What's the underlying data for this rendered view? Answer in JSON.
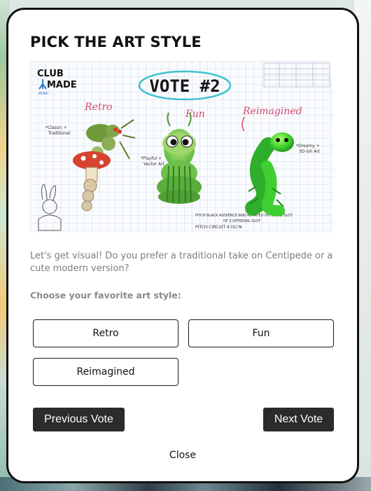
{
  "modal": {
    "title": "PICK THE ART STYLE",
    "description": "Let's get visual! Do you prefer a traditional take on Centipede or a cute modern version?",
    "prompt": "Choose your favorite art style:",
    "options": [
      {
        "label": "Retro"
      },
      {
        "label": "Fun"
      },
      {
        "label": "Reimagined"
      }
    ],
    "previous_label": "Previous Vote",
    "next_label": "Next Vote",
    "close_label": "Close"
  },
  "artwork": {
    "logo_line1": "CLUB",
    "logo_line2": "MADE",
    "logo_sub": "ATARI",
    "heading": "VOTE #2",
    "labels": {
      "retro": "Retro",
      "fun": "Fun",
      "reimagined": "Reimagined"
    },
    "notes": {
      "retro": [
        "*Classic +",
        "Traditional"
      ],
      "fun": [
        "*Playful +",
        "Vector Art"
      ],
      "reimagined": [
        "*Dreamy +",
        "3D-ish Art"
      ],
      "footer": [
        "PITCH BLACK AUDIENCE AND ROTATED OFFERING SLOT",
        "OF 3 OFFERING SLOT",
        "PITCH CIRCUIT 4 (G) N"
      ]
    },
    "colors": {
      "paper": "#fafbfd",
      "grid": "#c3d4ea",
      "ellipse": "#3fc1cf",
      "ink_red": "#d24a6c",
      "green": "#3fbf3a"
    }
  }
}
